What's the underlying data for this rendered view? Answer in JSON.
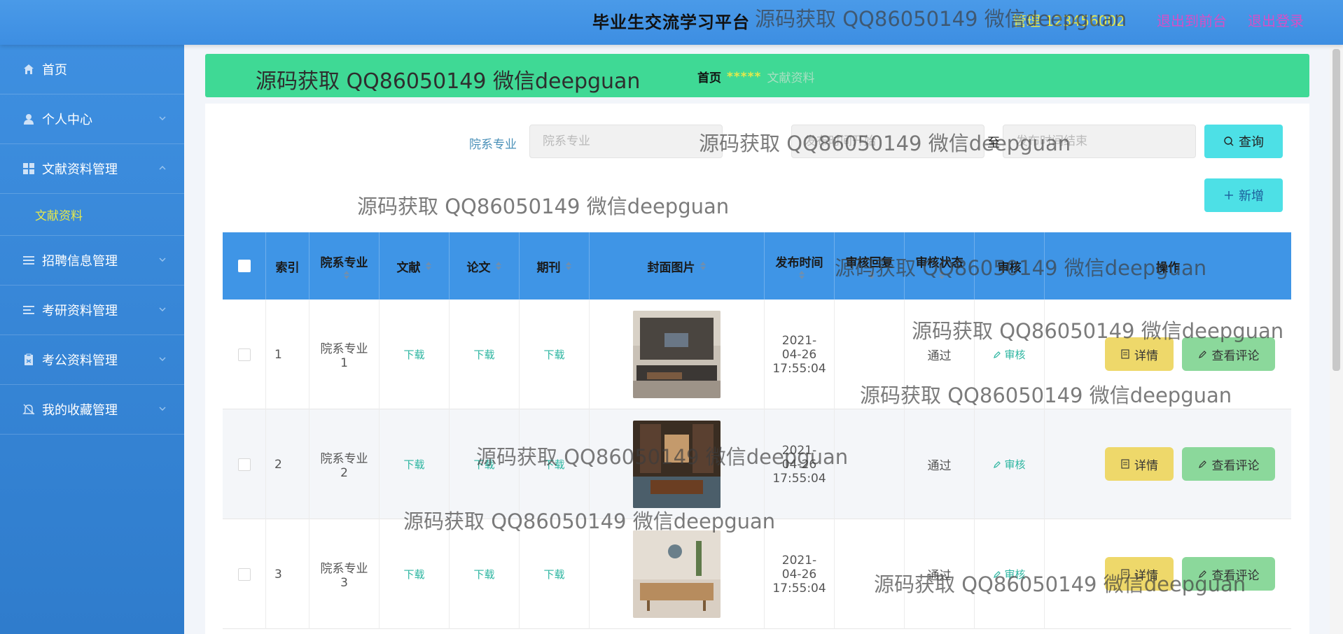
{
  "header": {
    "site_title": "毕业生交流学习平台",
    "user_info": "管理 123456002",
    "front_link": "退出到前台",
    "logout_link": "退出登录"
  },
  "sidebar": {
    "items": [
      {
        "label": "首页",
        "icon": "home-icon"
      },
      {
        "label": "个人中心",
        "icon": "user-icon"
      },
      {
        "label": "文献资料管理",
        "icon": "grid-icon"
      },
      {
        "label": "招聘信息管理",
        "icon": "list-icon"
      },
      {
        "label": "考研资料管理",
        "icon": "list-icon"
      },
      {
        "label": "考公资料管理",
        "icon": "clipboard-icon"
      },
      {
        "label": "我的收藏管理",
        "icon": "bell-icon"
      }
    ],
    "submenu": {
      "label": "文献资料"
    }
  },
  "banner": {
    "title": "源码获取 QQ86050149 微信deepguan",
    "breadcrumb_home": "首页",
    "breadcrumb_sep": "*****",
    "breadcrumb_current": "文献资料"
  },
  "search": {
    "label": "院系专业",
    "placeholder": "院系专业",
    "date_start_placeholder": "发布时间开始",
    "date_to": "至",
    "date_end_placeholder": "发布时间结束",
    "query_button": "查询",
    "add_button": "新增"
  },
  "table": {
    "columns": [
      "索引",
      "院系专业",
      "文献",
      "论文",
      "期刊",
      "封面图片",
      "发布时间",
      "审核回复",
      "审核状态",
      "审核",
      "操作"
    ],
    "rows": [
      {
        "index": "1",
        "major": "院系专业1",
        "doc": "下载",
        "paper": "下载",
        "journal": "下载",
        "time": "2021-04-26 17:55:04",
        "reply": "",
        "status": "通过",
        "approve": "审核",
        "detail": "详情",
        "comment": "查看评论"
      },
      {
        "index": "2",
        "major": "院系专业2",
        "doc": "下载",
        "paper": "下载",
        "journal": "下载",
        "time": "2021-04-26 17:55:04",
        "reply": "",
        "status": "通过",
        "approve": "审核",
        "detail": "详情",
        "comment": "查看评论"
      },
      {
        "index": "3",
        "major": "院系专业3",
        "doc": "下载",
        "paper": "下载",
        "journal": "下载",
        "time": "2021-04-26 17:55:04",
        "reply": "",
        "status": "通过",
        "approve": "审核",
        "detail": "详情",
        "comment": "查看评论"
      }
    ]
  },
  "watermark": {
    "text": "源码获取 QQ86050149 微信deepguan"
  },
  "colors": {
    "topbar": "#4a9ae8",
    "sidebar": "#3e8fe0",
    "banner": "#3fd995",
    "accent": "#4de0e6",
    "highlight": "#e7e94a"
  }
}
